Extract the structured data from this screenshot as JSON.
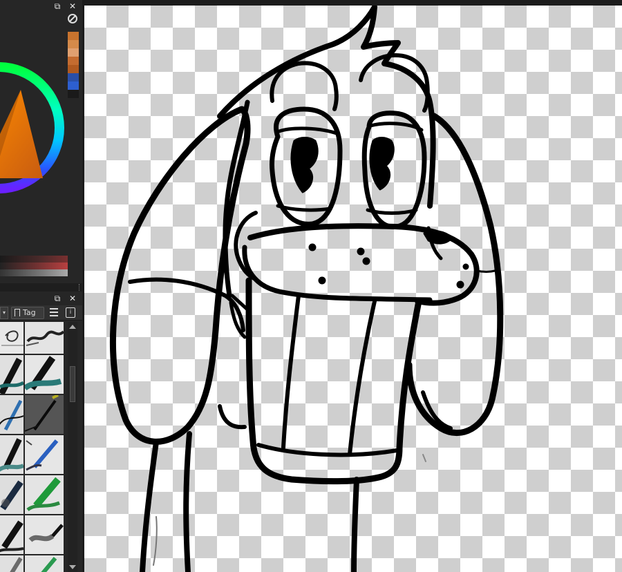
{
  "colors": {
    "dock_bg": "#262626",
    "canvas_border": "#1c1c1c",
    "checker_light": "#ffffff",
    "checker_dark": "#cfcfcf",
    "ink": "#000000",
    "selected_color": "#e8871a"
  },
  "color_docker": {
    "float_icon": "float-icon",
    "close_icon": "close-icon",
    "block_icon": "no-color-icon",
    "history_swatches": [
      "#c8732e",
      "#d48a4a",
      "#e0a070",
      "#c46c30",
      "#b05a20",
      "#2a4fa8",
      "#2d5fd0",
      "#1a1a1a"
    ]
  },
  "brush_docker": {
    "tag_label": "Tag",
    "float_icon": "float-icon",
    "close_icon": "close-icon",
    "menu_icon": "hamburger-icon",
    "info_icon": "info-icon",
    "presets": [
      {
        "name": "ink-swirl"
      },
      {
        "name": "charcoal-smudge"
      },
      {
        "name": "round-brush"
      },
      {
        "name": "teal-bristle"
      },
      {
        "name": "ink-pen"
      },
      {
        "name": "fine-liner"
      },
      {
        "name": "wet-paint"
      },
      {
        "name": "blue-marker"
      },
      {
        "name": "airbrush"
      },
      {
        "name": "green-bristle"
      },
      {
        "name": "flat-brush"
      },
      {
        "name": "dry-brush"
      },
      {
        "name": "blender"
      },
      {
        "name": "green-marker"
      }
    ]
  }
}
